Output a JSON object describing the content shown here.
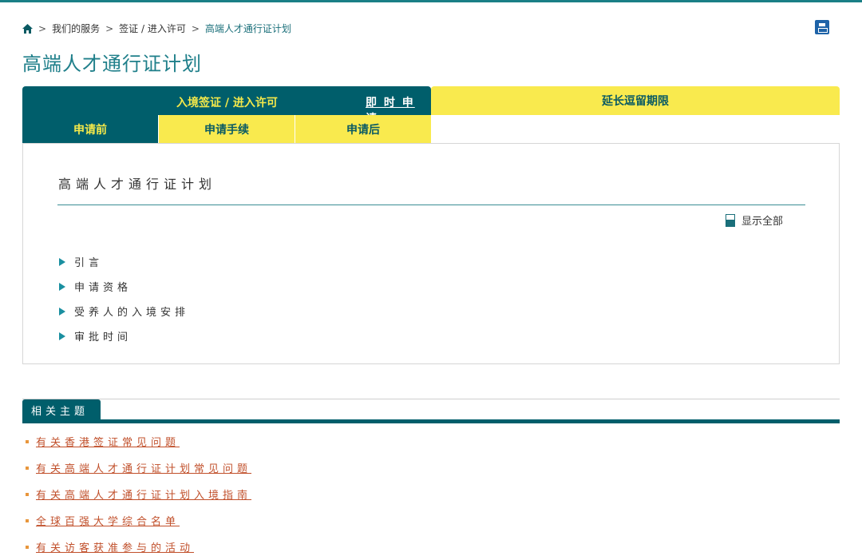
{
  "breadcrumb": {
    "items": [
      "我们的服务",
      "签证 / 进入许可",
      "高端人才通行证计划"
    ],
    "separator": ">"
  },
  "page_title": "高端人才通行证计划",
  "tabs": {
    "main_label": "入境签证 / 进入许可",
    "apply_label": "即 时 申 请",
    "extend_label": "延长逗留期限",
    "sub": [
      "申请前",
      "申请手续",
      "申请后"
    ]
  },
  "section": {
    "title": "高端人才通行证计划",
    "show_all": "显示全部",
    "items": [
      "引言",
      "申请资格",
      "受养人的入境安排",
      "审批时间"
    ]
  },
  "related": {
    "header": "相关主题",
    "links": [
      "有关香港签证常见问题",
      "有关高端人才通行证计划常见问题",
      "有关高端人才通行证计划入境指南",
      "全球百强大学综合名单",
      "有关访客获准参与的活动"
    ]
  },
  "colors": {
    "teal_dark": "#005e6b",
    "yellow": "#f9ea4e",
    "title_teal": "#1f7f8a",
    "link_orange": "#c1502b"
  }
}
